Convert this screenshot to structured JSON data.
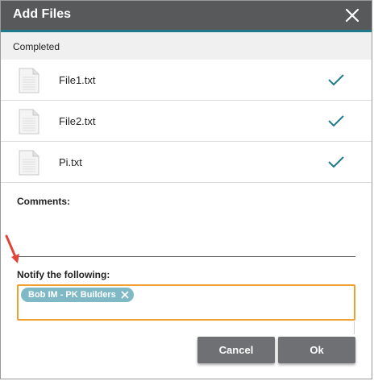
{
  "dialog": {
    "title": "Add Files",
    "status": "Completed"
  },
  "files": [
    {
      "name": "File1.txt",
      "icon": "file-icon",
      "status_icon": "check-icon"
    },
    {
      "name": "File2.txt",
      "icon": "file-icon",
      "status_icon": "check-icon"
    },
    {
      "name": "Pi.txt",
      "icon": "file-icon",
      "status_icon": "check-icon"
    }
  ],
  "comments": {
    "label": "Comments:",
    "value": ""
  },
  "notify": {
    "label": "Notify the following:",
    "recipients": [
      "Bob IM - PK Builders"
    ]
  },
  "buttons": {
    "cancel": "Cancel",
    "ok": "Ok"
  },
  "colors": {
    "title_bar": "#57595b",
    "accent": "#1f7a8c",
    "check": "#1f7a8c",
    "chip": "#7fb9c5",
    "notify_border": "#f0a030",
    "button": "#6e7073",
    "annotation_arrow": "#e0453a"
  }
}
